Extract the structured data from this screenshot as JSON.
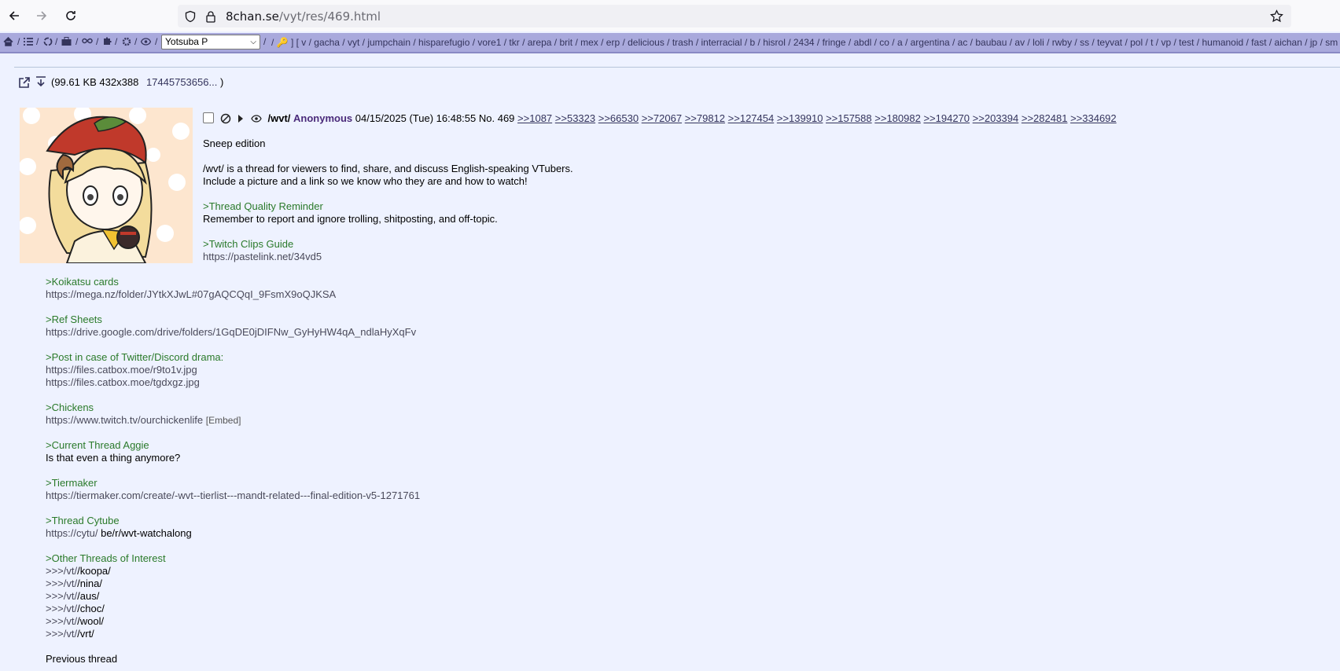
{
  "browser": {
    "url_host": "8chan.se",
    "url_path": "/vyt/res/469.html"
  },
  "topnav": {
    "style_select": "Yotsuba P",
    "boards_text": "/ 🔑 ] [ v / gacha / vyt / jumpchain / hisparefugio / vore1 / tkr / arepa / brit / mex / erp / delicious / trash / interracial / b / hisrol / 2434 / fringe / abdl / co / a / argentina / ac / baubau / av / loli / rwby / ss / teyvat / pol / t / vp / test / humanoid / fast / aichan / jp / sm / s"
  },
  "file": {
    "meta": "(99.61 KB  432x388",
    "filename": "17445753656...",
    "close": ")"
  },
  "post": {
    "board": "/wvt/",
    "name": "Anonymous",
    "date": "04/15/2025 (Tue) 16:48:55",
    "number": "No. 469",
    "backlinks": [
      ">>1087",
      ">>53323",
      ">>66530",
      ">>72067",
      ">>79812",
      ">>127454",
      ">>139910",
      ">>157588",
      ">>180982",
      ">>194270",
      ">>203394",
      ">>282481",
      ">>334692"
    ]
  },
  "message": {
    "l1": "Sneep edition",
    "l2": "/wvt/ is a thread for viewers to find, share, and discuss English-speaking VTubers.",
    "l3": "Include a picture and a link so we know who they are and how to watch!",
    "l4": ">Thread Quality Reminder",
    "l5": "Remember to report and ignore trolling, shitposting, and off-topic.",
    "l6": ">Twitch Clips Guide",
    "l7": "https://pastelink.net/34vd5",
    "l8": ">Koikatsu cards",
    "l9": "https://mega.nz/folder/JYtkXJwL#07gAQCQqI_9FsmX9oQJKSA",
    "l10": ">Ref Sheets",
    "l11": "https://drive.google.com/drive/folders/1GqDE0jDIFNw_GyHyHW4qA_ndlaHyXqFv",
    "l12": ">Post in case of Twitter/Discord drama:",
    "l13": "https://files.catbox.moe/r9to1v.jpg",
    "l14": "https://files.catbox.moe/tgdxgz.jpg",
    "l15": ">Chickens",
    "l16": "https://www.twitch.tv/ourchickenlife",
    "l16e": "[Embed]",
    "l17": ">Current Thread Aggie",
    "l18": "Is that even a thing anymore?",
    "l19": ">Tiermaker",
    "l20": "https://tiermaker.com/create/-wvt--tierlist---mandt-related---final-edition-v5-1271761",
    "l21": ">Thread Cytube",
    "l22a": "https://cytu/",
    "l22b": " be/r/wvt-watchalong",
    "l23": ">Other Threads of Interest",
    "t1a": ">>>/vt/",
    "t1b": "/koopa/",
    "t2a": ">>>/vt/",
    "t2b": "/nina/",
    "t3a": ">>>/vt/",
    "t3b": "/aus/",
    "t4a": ">>>/vt/",
    "t4b": "/choc/",
    "t5a": ">>>/vt/",
    "t5b": "/wool/",
    "t6a": ">>>/vt/",
    "t6b": "/vrt/",
    "l24": "Previous thread"
  }
}
